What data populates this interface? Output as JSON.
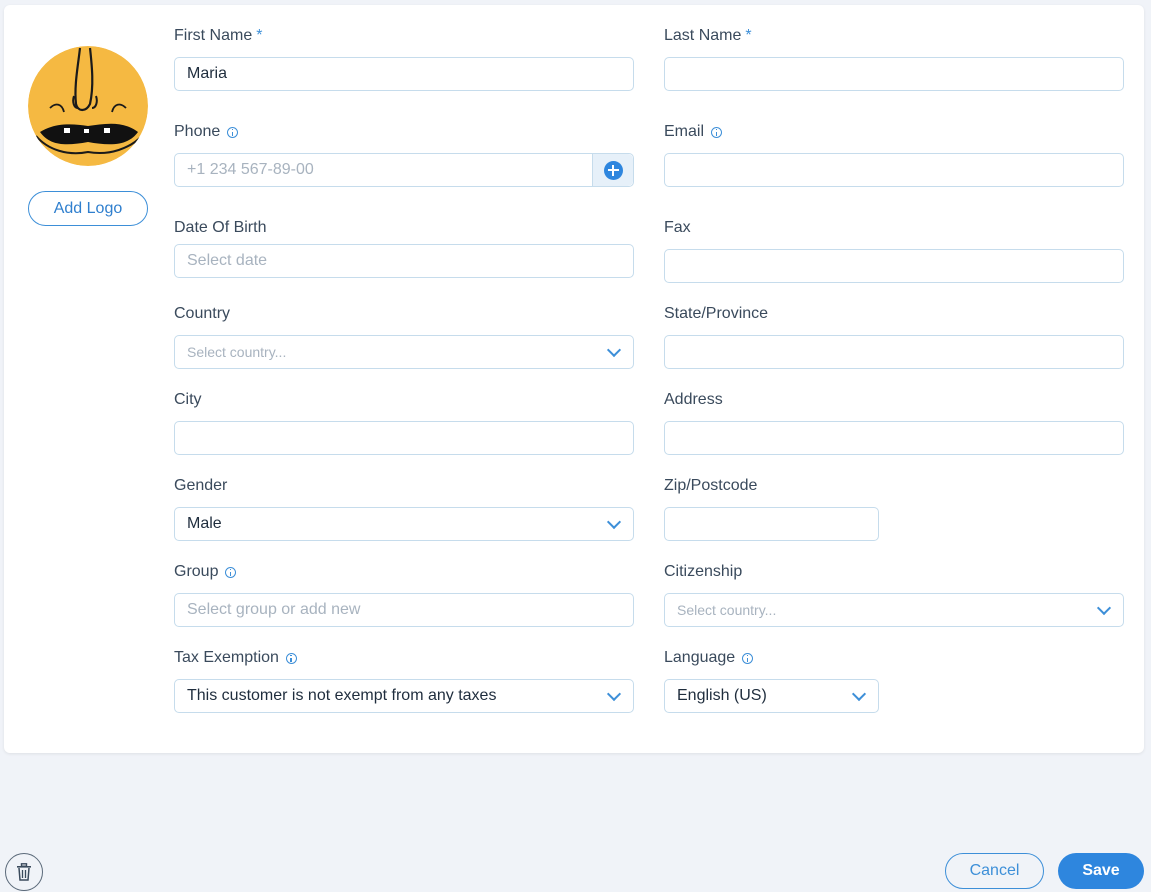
{
  "profile": {
    "add_logo_label": "Add Logo"
  },
  "fields": {
    "first_name": {
      "label": "First Name",
      "required_mark": "*",
      "value": "Maria"
    },
    "last_name": {
      "label": "Last Name",
      "required_mark": "*",
      "value": ""
    },
    "phone": {
      "label": "Phone",
      "placeholder": "+1 234 567-89-00"
    },
    "email": {
      "label": "Email",
      "value": ""
    },
    "date_of_birth": {
      "label": "Date Of Birth",
      "placeholder": "Select date"
    },
    "fax": {
      "label": "Fax",
      "value": ""
    },
    "country": {
      "label": "Country",
      "placeholder": "Select country..."
    },
    "state": {
      "label": "State/Province",
      "value": ""
    },
    "city": {
      "label": "City",
      "value": ""
    },
    "address": {
      "label": "Address",
      "value": ""
    },
    "gender": {
      "label": "Gender",
      "value": "Male"
    },
    "zip": {
      "label": "Zip/Postcode",
      "value": ""
    },
    "group": {
      "label": "Group",
      "placeholder": "Select group or add new"
    },
    "citizenship": {
      "label": "Citizenship",
      "placeholder": "Select country..."
    },
    "tax_exemption": {
      "label": "Tax Exemption",
      "value": "This customer is not exempt from any taxes"
    },
    "language": {
      "label": "Language",
      "value": "English (US)"
    }
  },
  "footer": {
    "cancel_label": "Cancel",
    "save_label": "Save"
  },
  "colors": {
    "accent": "#2e86de",
    "avatar_bg": "#f5b942",
    "background": "#f0f3f8"
  },
  "icons": [
    "info-icon",
    "plus-circle-icon",
    "chevron-down-icon",
    "trash-icon"
  ]
}
